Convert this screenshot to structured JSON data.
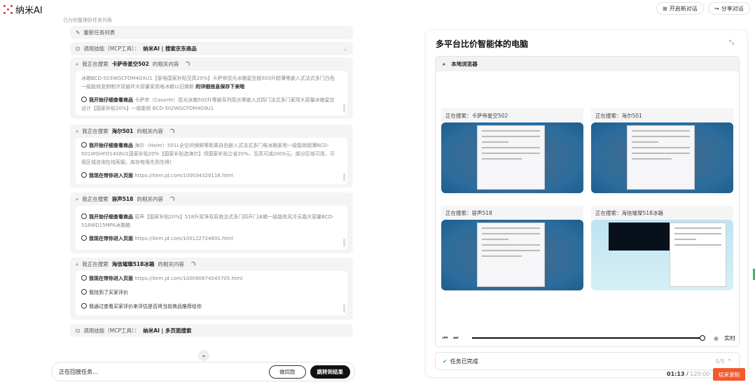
{
  "app": {
    "name": "纳米AI"
  },
  "header": {
    "new_chat": "开启新对话",
    "share": "分享对话"
  },
  "chat": {
    "faded_text": "已为你整理好任务列表",
    "update_tasks": "重新任务列表",
    "skill1": {
      "label": "调用技能（MCP工具）：",
      "value": "纳米AI | 搜索京东商品"
    },
    "searches": [
      {
        "prefix": "我正在搜索",
        "term": "卡萨帝星空502",
        "suffix": "的相关内容",
        "items": [
          {
            "plain": "冰箱BCD-503WGCFDM4GXU1【家电国家补贴至高20%】卡萨帝揽光冰箱星空版503升超薄零嵌入式法式多门白色一级能效变频制冷双循环大容量家用电冰箱以旧换新",
            "bold": "的详细信息保存下来啦"
          },
          {
            "bold": "我开始仔细查看商品",
            "plain": "卡萨帝（Casarte）揽光冰箱502升零嵌系列揽光零嵌入式四门法式多门家用大容量冰箱星空设计【国家补贴20%】一级能效 BCD-502WGCFDM4G9U1"
          }
        ]
      },
      {
        "prefix": "我正在搜索",
        "term": "海尔501",
        "suffix": "的相关内容",
        "items": [
          {
            "bold": "我开始仔细查看商品",
            "plain": "海尔（Haier）501L全空间保鲜零距离自由嵌入式法式多门电冰箱家用一级能效超薄BCD-501WGHFD14S8U1国家补贴20%【国家补贴选海尔】领国家补贴立省20%，至高可减2000元，部分区域可用，可用区域咨询在线客服，库存有限先到先得！"
          },
          {
            "bold": "我现在带你进入页面",
            "plain": "https://item.jd.com/100034329116.html"
          }
        ]
      },
      {
        "prefix": "我正在搜索",
        "term": "容声518",
        "suffix": "的相关内容",
        "items": [
          {
            "bold": "我开始仔细查看商品",
            "plain": "容声【国家补贴20%】518升双净双系统法式多门四开门冰箱一级能效风冷无霜大容量BCD-518WD15MPA冰箱箱"
          },
          {
            "bold": "我现在带你进入页面",
            "plain": "https://item.jd.com/100122724801.html"
          }
        ]
      },
      {
        "prefix": "我正在搜索",
        "term": "海信璀璨518冰箱",
        "suffix": "的相关内容",
        "items": [
          {
            "bold": "我现在带你进入页面",
            "plain": "https://item.jd.com/100090874045705.html"
          },
          {
            "bold": "",
            "plain": "我找到了买家评价"
          },
          {
            "bold": "",
            "plain": "我通过查看买家评价来评估是否将当前商品推荐给你"
          }
        ]
      }
    ],
    "skill2": {
      "label": "调用技能（MCP工具）：",
      "value": "纳米AI | 多页面搜索"
    }
  },
  "input": {
    "status": "正在回放任务...",
    "same_button": "做同款",
    "jump_button": "跳转到结果"
  },
  "panel": {
    "title": "多平台比价智能体的电脑",
    "browser_label": "本地浏览器",
    "tiles": [
      {
        "label": "正在搜索：卡萨帝星空502"
      },
      {
        "label": "正在搜索：海尔501"
      },
      {
        "label": "正在搜索：容声518"
      },
      {
        "label": "正在搜索：海信璀璨518冰箱"
      }
    ],
    "realtime": "实时",
    "progress": 1.0,
    "task_done": "任务已完成",
    "task_count": "5/5",
    "timer_elapsed": "01:13",
    "timer_total": "120:00",
    "end_recording": "结束录制"
  },
  "colors": {
    "accent": "#f15a2b",
    "brand": "#e0303a"
  }
}
